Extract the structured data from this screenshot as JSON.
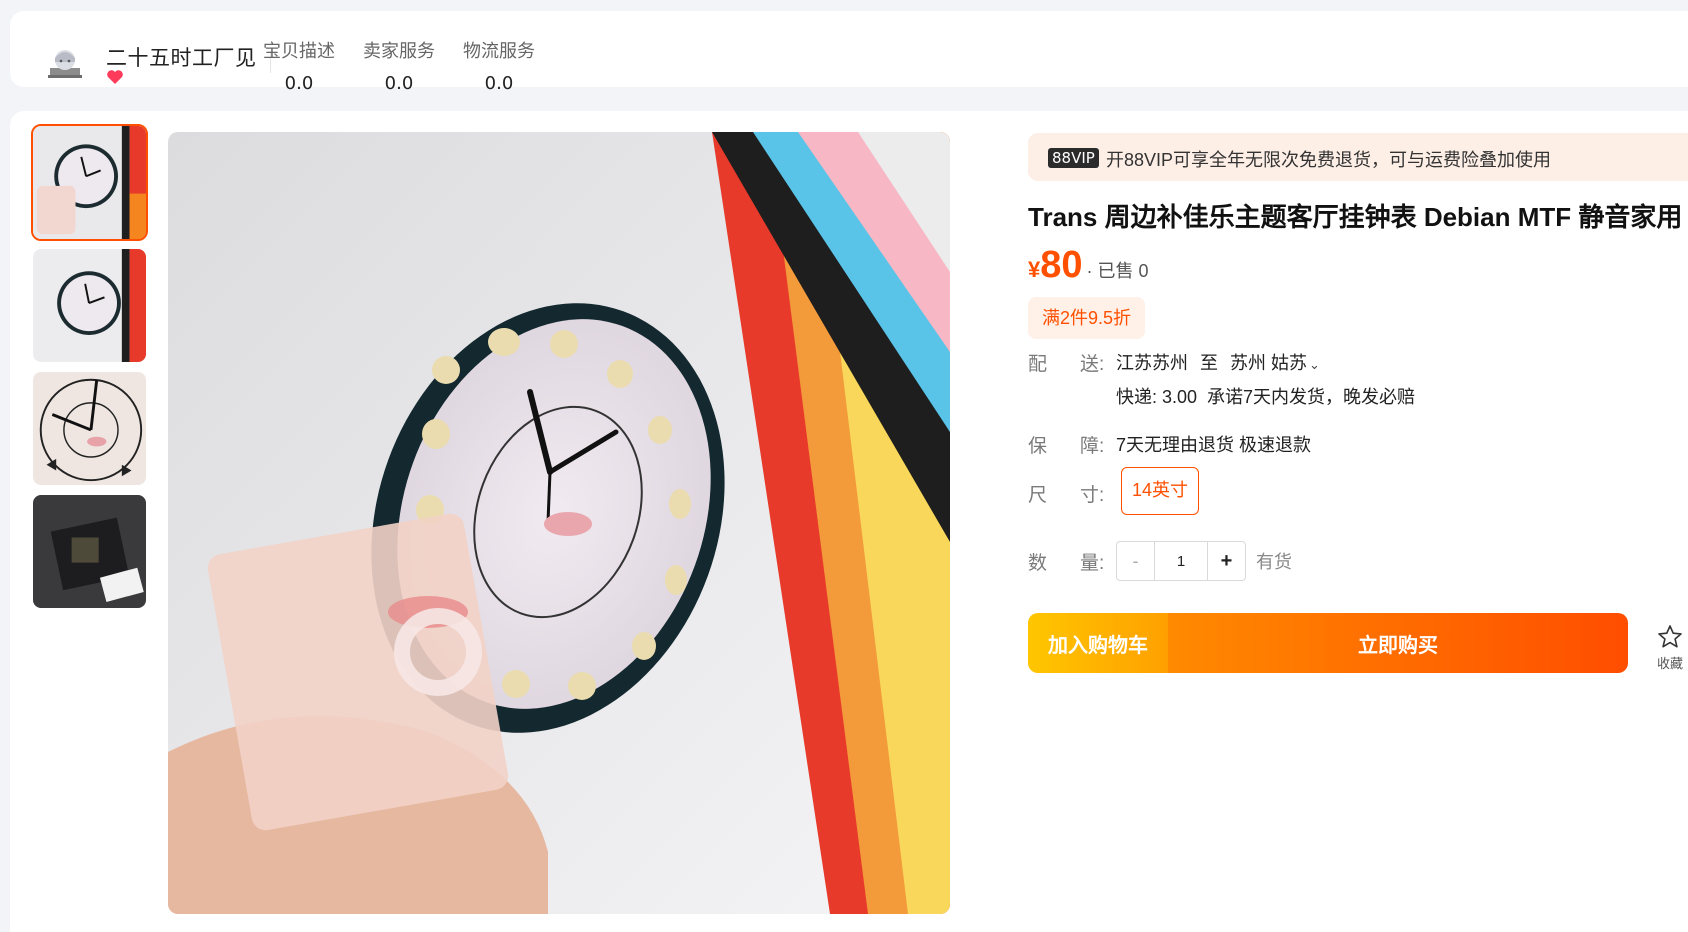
{
  "shop": {
    "name": "二十五时工厂见",
    "avatar_icon": "avatar",
    "heart_icon": "heart-icon",
    "scores": [
      {
        "label": "宝贝描述",
        "value": "0.0"
      },
      {
        "label": "卖家服务",
        "value": "0.0"
      },
      {
        "label": "物流服务",
        "value": "0.0"
      }
    ]
  },
  "gallery": {
    "thumbnail_count": 4,
    "active_index": 0
  },
  "product": {
    "vip_badge": "88VIP",
    "vip_text": "开88VIP可享全年无限次免费退货，可与运费险叠加使用",
    "title": "Trans 周边补佳乐主题客厅挂钟表 Debian MTF 静音家用",
    "currency": "¥",
    "price": "80",
    "sold": "· 已售 0",
    "promo": "满2件9.5折",
    "shipping": {
      "label_1": "配",
      "label_2": "送:",
      "from": "江苏苏州",
      "to_word": "至",
      "destination": "苏州 姑苏",
      "chevron_icon": "chevron-down-icon",
      "fee": "快递: 3.00",
      "promise": "承诺7天内发货，晚发必赔"
    },
    "guarantee": {
      "label_1": "保",
      "label_2": "障:",
      "text": "7天无理由退货 极速退款"
    },
    "size": {
      "label_1": "尺",
      "label_2": "寸:",
      "selected": "14英寸"
    },
    "quantity": {
      "label_1": "数",
      "label_2": "量:",
      "minus": "-",
      "value": "1",
      "plus": "+",
      "stock": "有货"
    },
    "buttons": {
      "cart": "加入购物车",
      "buy": "立即购买",
      "favorite": "收藏"
    }
  },
  "colors": {
    "accent": "#ff5000",
    "cart_gradient_start": "#ffc600",
    "buy_gradient_end": "#ff4d00",
    "vip_bg": "#fdeee6"
  }
}
